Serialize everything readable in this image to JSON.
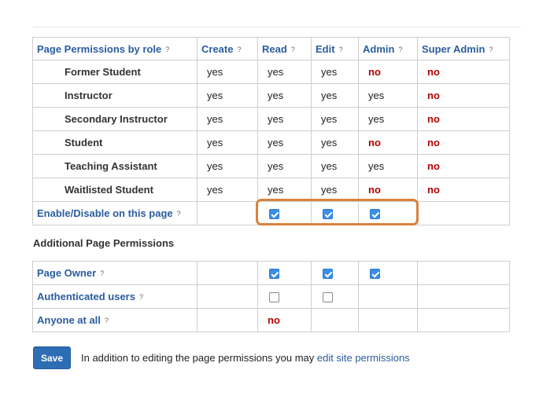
{
  "permissions_table": {
    "headers": [
      "Page Permissions by role",
      "Create",
      "Read",
      "Edit",
      "Admin",
      "Super Admin"
    ],
    "help_glyph": "?",
    "rows": [
      {
        "role": "Former Student",
        "create": "yes",
        "read": "yes",
        "edit": "yes",
        "admin": "no",
        "super_admin": "no"
      },
      {
        "role": "Instructor",
        "create": "yes",
        "read": "yes",
        "edit": "yes",
        "admin": "yes",
        "super_admin": "no"
      },
      {
        "role": "Secondary Instructor",
        "create": "yes",
        "read": "yes",
        "edit": "yes",
        "admin": "yes",
        "super_admin": "no"
      },
      {
        "role": "Student",
        "create": "yes",
        "read": "yes",
        "edit": "yes",
        "admin": "no",
        "super_admin": "no"
      },
      {
        "role": "Teaching Assistant",
        "create": "yes",
        "read": "yes",
        "edit": "yes",
        "admin": "yes",
        "super_admin": "no"
      },
      {
        "role": "Waitlisted Student",
        "create": "yes",
        "read": "yes",
        "edit": "yes",
        "admin": "no",
        "super_admin": "no"
      }
    ],
    "enable_row": {
      "label": "Enable/Disable on this page",
      "read_checked": true,
      "edit_checked": true,
      "admin_checked": true
    }
  },
  "additional": {
    "title": "Additional Page Permissions",
    "rows": [
      {
        "label": "Page Owner",
        "read_checked": true,
        "edit_checked": true,
        "admin_checked": true
      },
      {
        "label": "Authenticated users",
        "read_checked": false,
        "edit_checked": false
      },
      {
        "label": "Anyone at all",
        "read_text": "no"
      }
    ]
  },
  "footer": {
    "save_label": "Save",
    "text": "In addition to editing the page permissions you may ",
    "link_text": "edit site permissions"
  },
  "colors": {
    "accent": "#2a5d9e",
    "no": "#b40000",
    "highlight": "#d9823e",
    "checkbox": "#3a8ee6"
  }
}
